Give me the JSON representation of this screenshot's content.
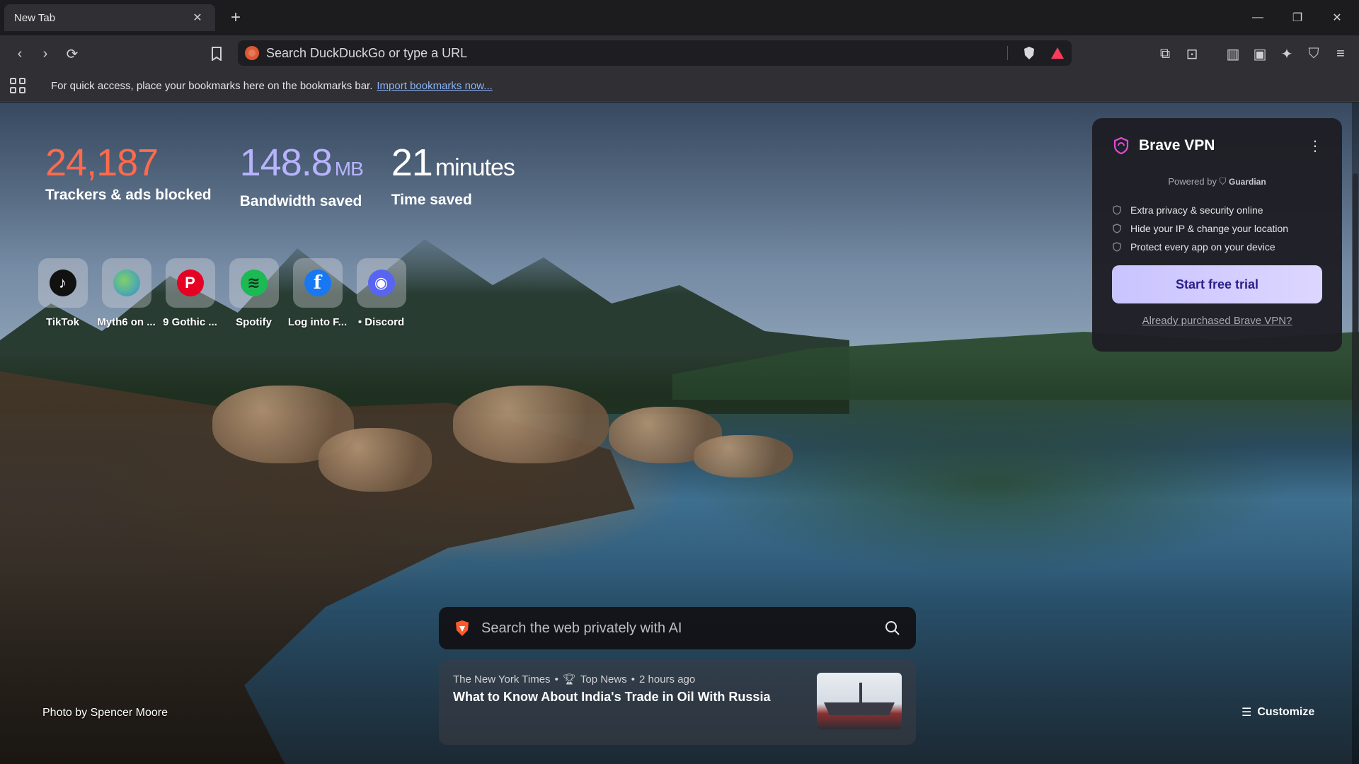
{
  "tab": {
    "title": "New Tab",
    "close_icon": "close-icon",
    "new_tab_icon": "plus-icon"
  },
  "window_controls": {
    "minimize": "minimize-icon",
    "restore": "restore-icon",
    "close": "close-icon"
  },
  "toolbar": {
    "omnibox_placeholder": "Search DuckDuckGo or type a URL",
    "icons": [
      "back-icon",
      "forward-icon",
      "reload-icon",
      "bookmark-icon",
      "brave-shields-icon",
      "brave-rewards-icon",
      "extensions-icon",
      "search-tabs-icon",
      "sidebar-icon",
      "wallet-icon",
      "leo-ai-icon",
      "vpn-icon",
      "menu-icon"
    ]
  },
  "bookmarks_bar": {
    "message": "For quick access, place your bookmarks here on the bookmarks bar.",
    "link": "Import bookmarks now..."
  },
  "stats": {
    "trackers": {
      "value": "24,187",
      "label": "Trackers & ads blocked"
    },
    "bandwidth": {
      "value": "148.8",
      "unit": "MB",
      "label": "Bandwidth saved"
    },
    "time": {
      "value": "21",
      "unit": "minutes",
      "label": "Time saved"
    }
  },
  "top_sites": [
    {
      "label": "TikTok",
      "glyph": "♪",
      "color": "#111111"
    },
    {
      "label": "Myth6 on ...",
      "glyph": "●",
      "color": "#2f8fd8"
    },
    {
      "label": "9 Gothic ...",
      "glyph": "P",
      "color": "#e60023"
    },
    {
      "label": "Spotify",
      "glyph": "≋",
      "color": "#1db954"
    },
    {
      "label": "Log into F...",
      "glyph": "f",
      "color": "#1877f2"
    },
    {
      "label": "• Discord",
      "glyph": "◉",
      "color": "#5865f2"
    }
  ],
  "vpn": {
    "title": "Brave VPN",
    "powered_by": "Powered by",
    "partner": "Guardian",
    "features": [
      "Extra privacy & security online",
      "Hide your IP & change your location",
      "Protect every app on your device"
    ],
    "cta": "Start free trial",
    "already": "Already purchased Brave VPN?"
  },
  "search": {
    "placeholder": "Search the web privately with AI"
  },
  "news": {
    "source": "The New York Times",
    "category": "Top News",
    "age": "2 hours ago",
    "headline": "What to Know About India's Trade in Oil With Russia"
  },
  "photo_credit": "Photo by Spencer Moore",
  "customize_label": "Customize",
  "colors": {
    "tracker_accent": "#ff6a4d",
    "bandwidth_accent": "#b8b3ff",
    "vpn_button": "#c9c4ff"
  }
}
